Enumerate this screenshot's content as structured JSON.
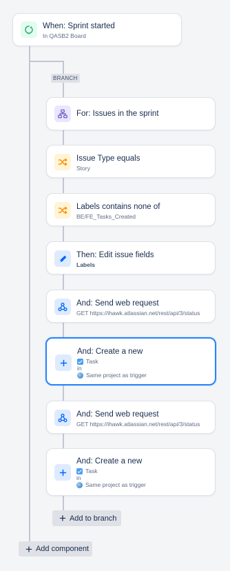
{
  "trigger": {
    "title": "When: Sprint started",
    "subtitle": "In QASB2 Board",
    "icon": "sprint-started-icon"
  },
  "branch_label": "BRANCH",
  "branch": {
    "for_card": {
      "title": "For: Issues in the sprint",
      "icon": "branch-icon"
    },
    "condition_1": {
      "title": "Issue Type equals",
      "subtitle": "Story",
      "icon": "condition-shuffle-icon"
    },
    "condition_2": {
      "title": "Labels contains none of",
      "subtitle": "BE/FE_Tasks_Created",
      "icon": "condition-shuffle-icon"
    },
    "action_edit": {
      "title": "Then: Edit issue fields",
      "subtitle": "Labels",
      "icon": "pencil-icon"
    },
    "web_request_1": {
      "title": "And: Send web request",
      "subtitle": "GET https://ihawk.atlassian.net/rest/api/3/status",
      "icon": "webhook-icon"
    },
    "create_1": {
      "title": "And: Create a new",
      "issue_type": "Task",
      "in_label": "in",
      "project": "Same project as trigger",
      "icon": "plus-icon"
    },
    "web_request_2": {
      "title": "And: Send web request",
      "subtitle": "GET https://ihawk.atlassian.net/rest/api/3/status",
      "icon": "webhook-icon"
    },
    "create_2": {
      "title": "And: Create a new",
      "issue_type": "Task",
      "in_label": "in",
      "project": "Same project as trigger",
      "icon": "plus-icon"
    },
    "add_to_branch": "Add to branch"
  },
  "add_component": "Add component",
  "colors": {
    "trigger_icon_bg": "#e3fcef",
    "trigger_icon": "#36b37e",
    "branch_icon_bg": "#eae6ff",
    "branch_icon": "#6554c0",
    "condition_icon_bg": "#fff4d6",
    "condition_icon": "#ff8b00",
    "action_icon_bg": "#deebff",
    "action_icon": "#0065ff",
    "selected_border": "#2684ff"
  }
}
